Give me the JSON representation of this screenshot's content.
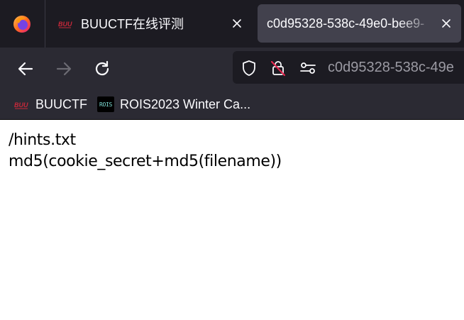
{
  "tabs": [
    {
      "title": "BUUCTF在线评测",
      "favicon": "buuctf-favicon",
      "active": false
    },
    {
      "title": "c0d95328-538c-49e0-bee9-",
      "favicon": "none",
      "active": true
    }
  ],
  "navbar": {
    "url": "c0d95328-538c-49e"
  },
  "bookmarks": [
    {
      "label": "BUUCTF",
      "icon": "buuctf-favicon"
    },
    {
      "label": "ROIS2023 Winter Ca...",
      "icon": "rois-favicon",
      "icon_text": "ROIS"
    }
  ],
  "page": {
    "lines": [
      "/hints.txt",
      "md5(cookie_secret+md5(filename))"
    ]
  },
  "colors": {
    "tabstrip": "#1c1b22",
    "toolbar": "#2b2a33",
    "active_tab": "#42414d",
    "urlbar": "#1c1b22",
    "text_light": "#fbfbfe",
    "url_text": "#9b9aa3",
    "icon_disabled": "#6c6b73",
    "lock_slash": "#e22850",
    "buuctf_red": "#c8283a"
  }
}
